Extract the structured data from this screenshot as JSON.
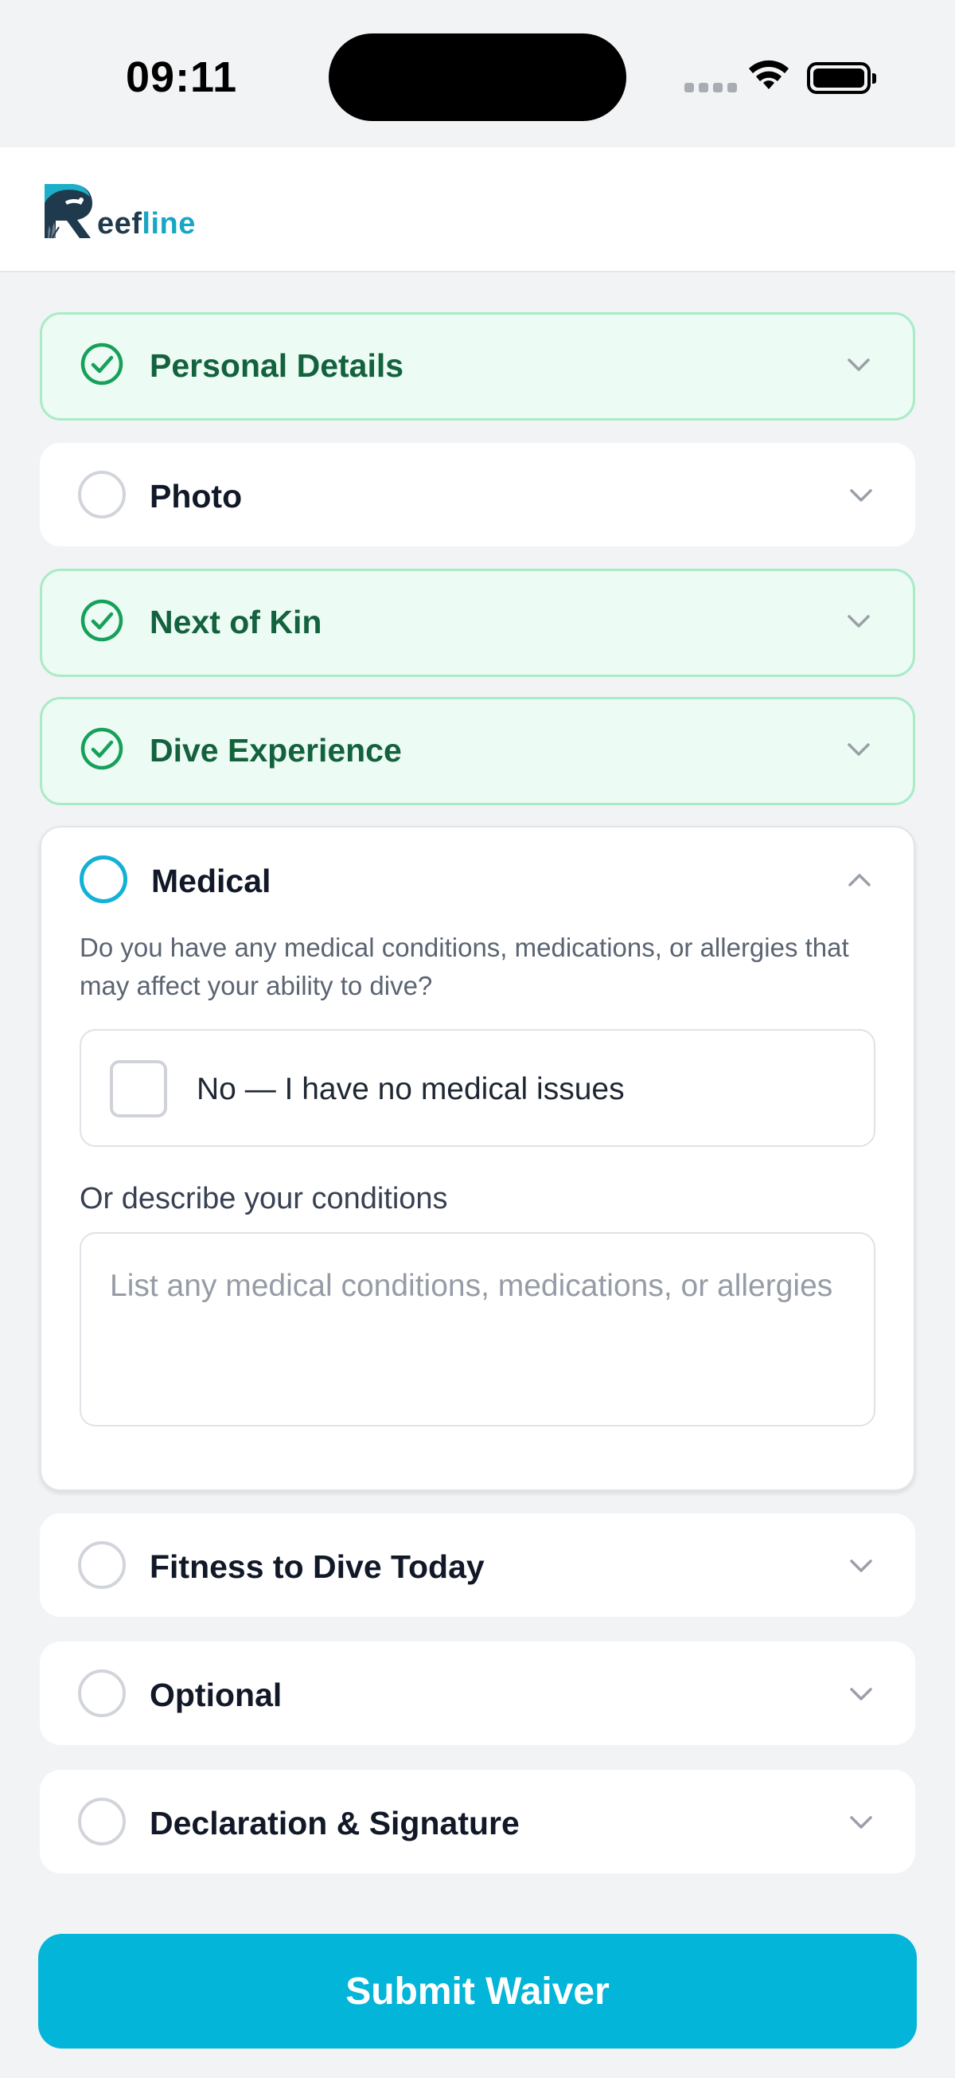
{
  "status_bar": {
    "time": "09:11"
  },
  "header": {
    "logo_text_prefix": "eef",
    "logo_text_accent": "line",
    "logo_icon": "reefline-logo-icon"
  },
  "sections": [
    {
      "id": "personal-details",
      "title": "Personal Details",
      "state": "complete",
      "expanded": false
    },
    {
      "id": "photo",
      "title": "Photo",
      "state": "incomplete",
      "expanded": false
    },
    {
      "id": "next-of-kin",
      "title": "Next of Kin",
      "state": "complete",
      "expanded": false
    },
    {
      "id": "dive-experience",
      "title": "Dive Experience",
      "state": "complete",
      "expanded": false
    },
    {
      "id": "medical",
      "title": "Medical",
      "state": "active",
      "expanded": true
    },
    {
      "id": "fitness-to-dive-today",
      "title": "Fitness to Dive Today",
      "state": "incomplete",
      "expanded": false
    },
    {
      "id": "optional",
      "title": "Optional",
      "state": "incomplete",
      "expanded": false
    },
    {
      "id": "declaration-signature",
      "title": "Declaration & Signature",
      "state": "incomplete",
      "expanded": false
    }
  ],
  "medical": {
    "question": "Do you have any medical conditions, medications, or allergies that may affect your ability to dive?",
    "no_issues_label": "No — I have no medical issues",
    "no_issues_checked": false,
    "conditions_label": "Or describe your conditions",
    "conditions_value": "",
    "conditions_placeholder": "List any medical conditions, medications, or allergies"
  },
  "submit_label": "Submit Waiver",
  "colors": {
    "brand": "#03b5d8",
    "complete_bg": "#ecfbf3",
    "complete_border": "#a9ebc7",
    "complete_text": "#13623d",
    "check_green": "#16a05a"
  }
}
